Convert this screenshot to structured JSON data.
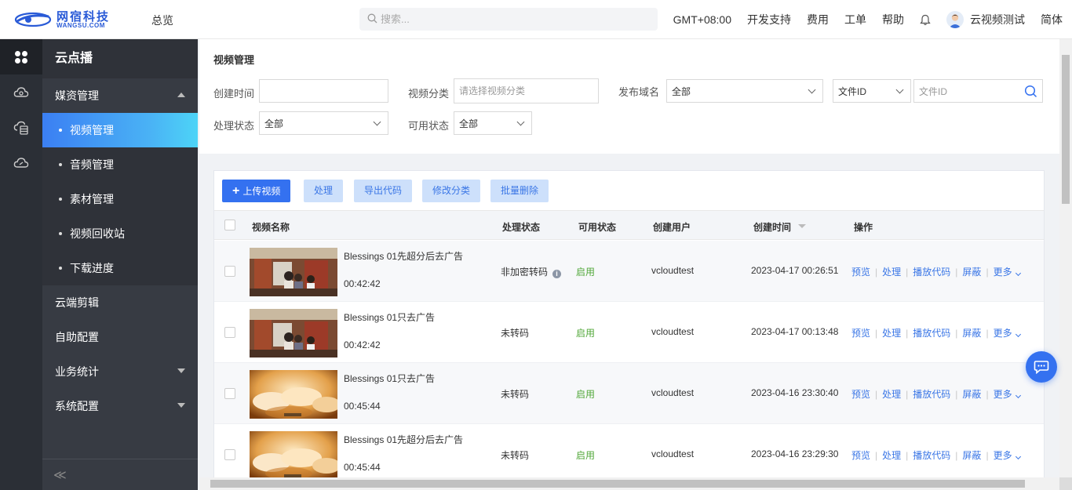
{
  "header": {
    "logo_cn": "网宿科技",
    "logo_en": "WANGSU.COM",
    "overview": "总览",
    "search_placeholder": "搜索...",
    "timezone": "GMT+08:00",
    "dev_support": "开发支持",
    "billing": "费用",
    "tickets": "工单",
    "help": "帮助",
    "user": "云视频测试",
    "language": "简体"
  },
  "sidebar": {
    "title": "云点播",
    "media_group": "媒资管理",
    "items": [
      "视频管理",
      "音频管理",
      "素材管理",
      "视频回收站",
      "下载进度"
    ],
    "groups": [
      "云端剪辑",
      "自助配置",
      "业务统计",
      "系统配置"
    ],
    "collapse_glyph": "≪"
  },
  "filters": {
    "page_title": "视频管理",
    "create_time_label": "创建时间",
    "category_label": "视频分类",
    "category_placeholder": "请选择视频分类",
    "domain_label": "发布域名",
    "domain_value": "全部",
    "id_type": "文件ID",
    "id_placeholder": "文件ID",
    "process_label": "处理状态",
    "process_value": "全部",
    "avail_label": "可用状态",
    "avail_value": "全部"
  },
  "toolbar": {
    "upload": "上传视频",
    "process": "处理",
    "export_code": "导出代码",
    "edit_category": "修改分类",
    "batch_delete": "批量删除"
  },
  "table": {
    "headers": {
      "name": "视频名称",
      "process": "处理状态",
      "avail": "可用状态",
      "user": "创建用户",
      "time": "创建时间",
      "ops": "操作"
    },
    "ops": {
      "preview": "预览",
      "process": "处理",
      "play_code": "播放代码",
      "block": "屏蔽",
      "more": "更多"
    },
    "rows": [
      {
        "name": "Blessings 01先超分后去广告",
        "duration": "00:42:42",
        "process": "非加密转码",
        "avail": "启用",
        "user": "vcloudtest",
        "time": "2023-04-17 00:26:51",
        "thumb": "store"
      },
      {
        "name": "Blessings 01只去广告",
        "duration": "00:42:42",
        "process": "未转码",
        "avail": "启用",
        "user": "vcloudtest",
        "time": "2023-04-17 00:13:48",
        "thumb": "store"
      },
      {
        "name": "Blessings 01只去广告",
        "duration": "00:45:44",
        "process": "未转码",
        "avail": "启用",
        "user": "vcloudtest",
        "time": "2023-04-16 23:30:40",
        "thumb": "dumpling"
      },
      {
        "name": "Blessings 01先超分后去广告",
        "duration": "00:45:44",
        "process": "未转码",
        "avail": "启用",
        "user": "vcloudtest",
        "time": "2023-04-16 23:29:30",
        "thumb": "dumpling"
      }
    ]
  },
  "colors": {
    "primary": "#3471f0",
    "sidebar_bg": "#373b43",
    "active_start": "#3b7ff3",
    "active_end": "#4dd4f7",
    "enabled_green": "#52a83a",
    "link": "#3a76e6"
  }
}
